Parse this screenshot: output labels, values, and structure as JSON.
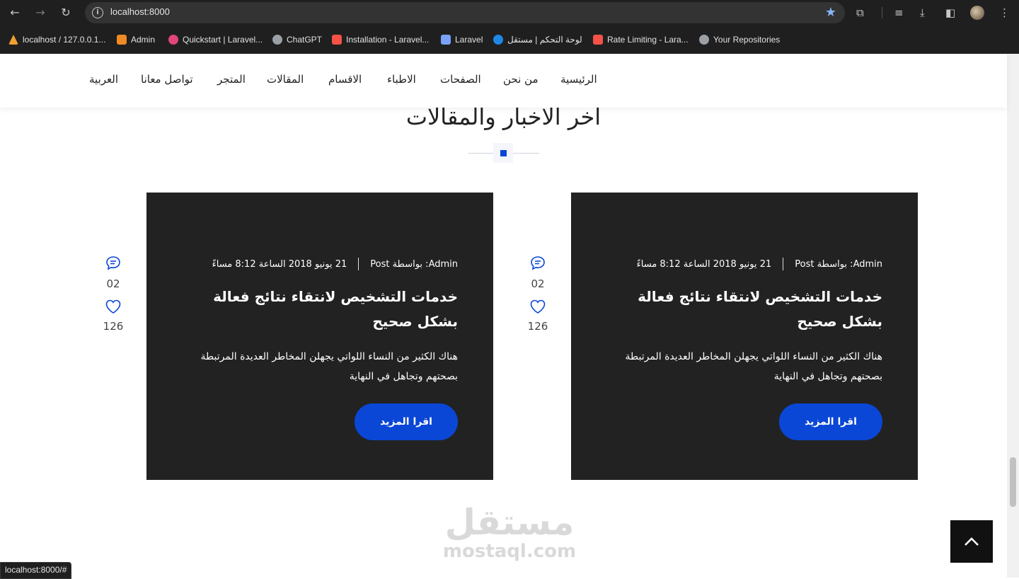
{
  "browser": {
    "url": "localhost:8000",
    "status_url": "localhost:8000/#",
    "bookmarks": [
      {
        "label": "localhost / 127.0.0.1...",
        "color": "#f0a030"
      },
      {
        "label": "Admin",
        "color": "#f08a24"
      },
      {
        "label": "Quickstart | Laravel...",
        "color": "#e0457b"
      },
      {
        "label": "ChatGPT",
        "color": "#9aa0a6"
      },
      {
        "label": "Installation - Laravel...",
        "color": "#f55247"
      },
      {
        "label": "Laravel",
        "color": "#7aa2f7"
      },
      {
        "label": "لوحة التحكم | مستقل",
        "color": "#1e88e5"
      },
      {
        "label": "Rate Limiting - Lara...",
        "color": "#f55247"
      },
      {
        "label": "Your Repositories",
        "color": "#9aa0a6"
      }
    ]
  },
  "nav": {
    "items": [
      "الرئيسية",
      "من نحن",
      "الصفحات",
      "الاطباء",
      "الاقسام",
      "المقالات",
      "المتجر",
      "تواصل معانا",
      "العربية"
    ]
  },
  "section": {
    "title": "آخر الأخبار والمقالات"
  },
  "cards": [
    {
      "author": "Admin: بواسطة Post",
      "date": "21 يونيو 2018 الساعة 8:12 مساءً",
      "title": "خدمات التشخيص لانتقاء نتائج فعالة بشكل صحيح",
      "excerpt": "هناك الكثير من النساء اللواتي يجهلن المخاطر العديدة المرتبطة بصحتهم وتجاهل في النهاية",
      "button": "اقرا المزيد",
      "comments": "02",
      "likes": "126"
    },
    {
      "author": "Admin: بواسطة Post",
      "date": "21 يونيو 2018 الساعة 8:12 مساءً",
      "title": "خدمات التشخيص لانتقاء نتائج فعالة بشكل صحيح",
      "excerpt": "هناك الكثير من النساء اللواتي يجهلن المخاطر العديدة المرتبطة بصحتهم وتجاهل في النهاية",
      "button": "اقرا المزيد",
      "comments": "02",
      "likes": "126"
    }
  ],
  "watermark": {
    "arabic": "مستقل",
    "latin": "mostaql.com"
  },
  "colors": {
    "accent": "#0a47d6",
    "card_bg": "#222222",
    "chrome_bg": "#1f1f1f"
  }
}
